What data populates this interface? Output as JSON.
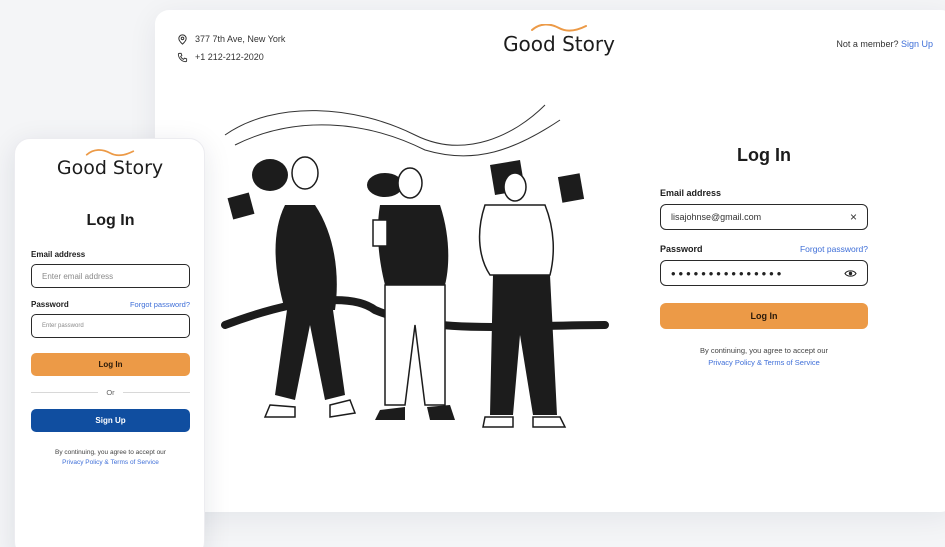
{
  "brand": {
    "name": "Good Story",
    "accent": "#ec9a47",
    "primary_blue": "#104ea0",
    "link_color": "#3f6fd8"
  },
  "contact": {
    "address": "377 7th Ave, New York",
    "phone": "+1 212-212-2020",
    "address_icon": "location-pin-icon",
    "phone_icon": "phone-icon"
  },
  "topbar": {
    "prompt": "Not a member?",
    "signup_link": "Sign Up"
  },
  "desktop_form": {
    "title": "Log In",
    "email_label": "Email address",
    "email_value": "lisajohnse@gmail.com",
    "clear_icon": "×",
    "password_label": "Password",
    "forgot_link": "Forgot password?",
    "password_mask": "•••••••••••••••",
    "reveal_icon": "eye-icon",
    "login_button": "Log In",
    "terms_text": "By continuing, you agree to accept our",
    "terms_link": "Privacy Policy & Terms of Service"
  },
  "mobile_form": {
    "title": "Log In",
    "email_label": "Email address",
    "email_placeholder": "Enter email address",
    "password_label": "Password",
    "forgot_link": "Forgot password?",
    "password_placeholder": "Enter password",
    "login_button": "Log In",
    "divider_text": "Or",
    "signup_button": "Sign Up",
    "terms_text": "By continuing, you agree to accept our",
    "terms_link": "Privacy Policy & Terms of Service"
  }
}
